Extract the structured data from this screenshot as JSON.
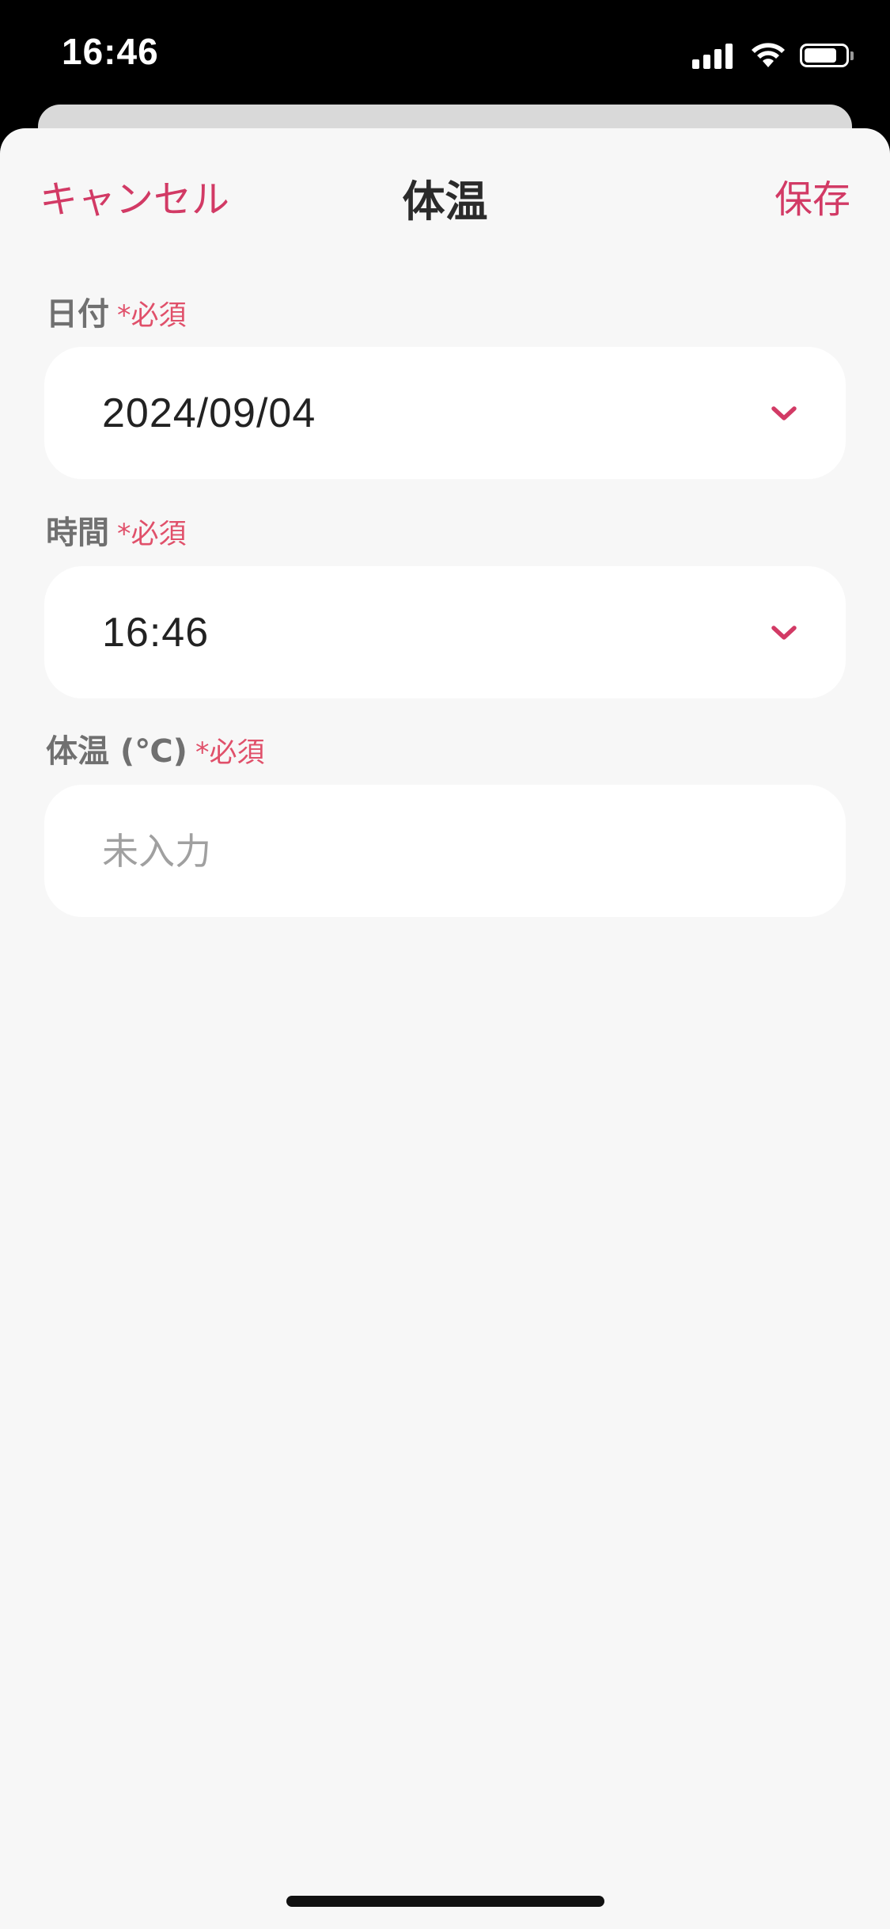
{
  "status_bar": {
    "time": "16:46",
    "icons": [
      "cellular-signal-icon",
      "wifi-icon",
      "battery-icon"
    ],
    "battery_level_fraction": 0.8
  },
  "nav": {
    "cancel_label": "キャンセル",
    "title": "体温",
    "save_label": "保存"
  },
  "fields": {
    "date": {
      "label": "日付",
      "required": "*必須",
      "value": "2024/09/04",
      "icon": "chevron-down-icon"
    },
    "time": {
      "label": "時間",
      "required": "*必須",
      "value": "16:46",
      "icon": "chevron-down-icon"
    },
    "temperature": {
      "label": "体温 (℃)",
      "required": "*必須",
      "value": "",
      "placeholder": "未入力"
    }
  },
  "colors": {
    "accent": "#d23a65",
    "required": "#e0506a",
    "label": "#707070",
    "sheet_background": "#f7f7f7",
    "field_background": "#ffffff",
    "placeholder": "#a0a0a0"
  }
}
